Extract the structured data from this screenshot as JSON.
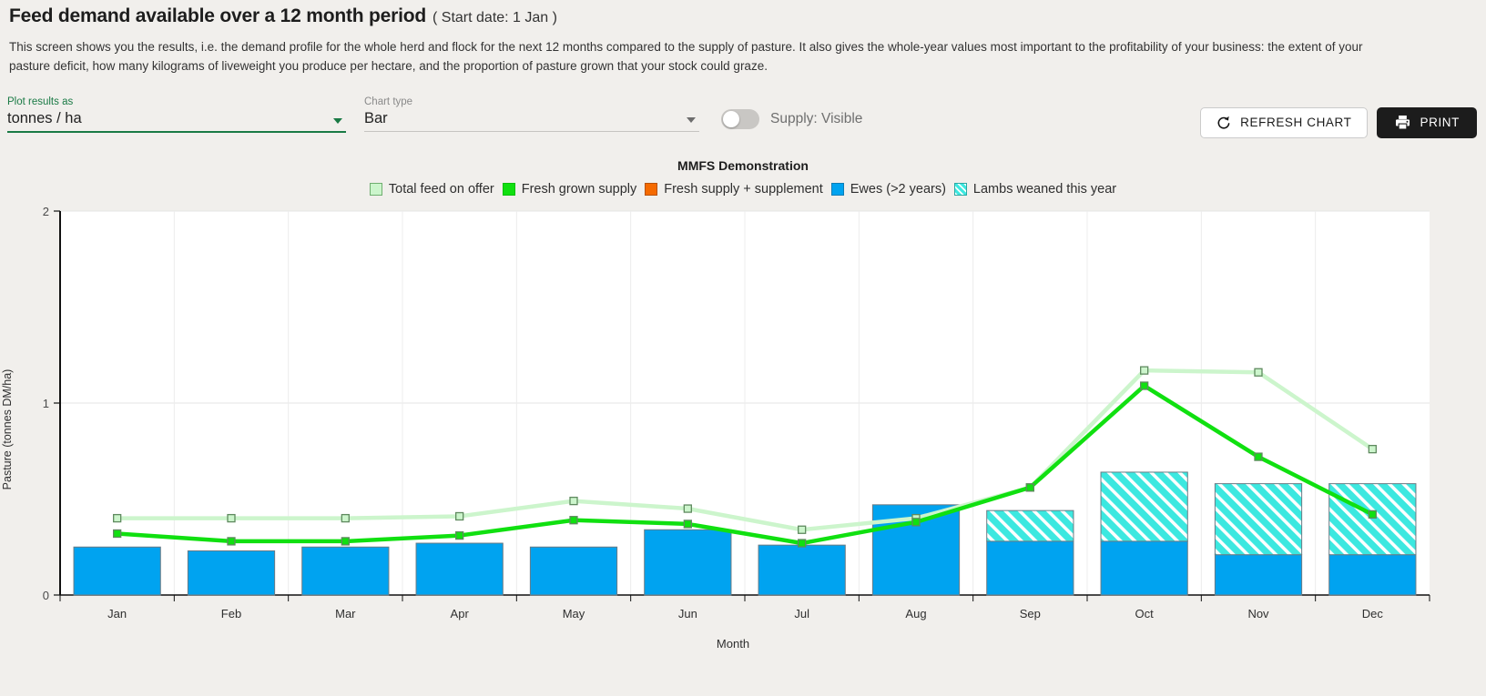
{
  "header": {
    "title": "Feed demand available over a 12 month period",
    "subtitle": "( Start date: 1 Jan )",
    "description": "This screen shows you the results, i.e. the demand profile for the whole herd and flock for the next 12 months compared to the supply of pasture. It also gives the whole-year values most important to the profitability of your business: the extent of your pasture deficit, how many kilograms of liveweight you produce per hectare, and the proportion of pasture grown that your stock could graze."
  },
  "controls": {
    "plot_results_as": {
      "label": "Plot results as",
      "value": "tonnes / ha"
    },
    "chart_type": {
      "label": "Chart type",
      "value": "Bar"
    },
    "supply_toggle": {
      "label": "Supply: Visible",
      "state": "off"
    },
    "refresh_button": "REFRESH CHART",
    "print_button": "PRINT"
  },
  "colors": {
    "total_feed": "#ccf5cc",
    "fresh_grown": "#10e010",
    "fresh_supplement": "#f56a00",
    "ewes": "#00a3f0",
    "lambs": "#3ce8e0",
    "accent_green": "#1a7a45",
    "background": "#f1efec"
  },
  "chart_data": {
    "type": "bar",
    "title": "MMFS Demonstration",
    "xlabel": "Month",
    "ylabel": "Pasture (tonnes DM/ha)",
    "ylim": [
      0,
      2
    ],
    "yticks": [
      0,
      1,
      2
    ],
    "ytick_labels": [
      "0",
      "1",
      "2"
    ],
    "grid": true,
    "legend_position": "top",
    "categories": [
      "Jan",
      "Feb",
      "Mar",
      "Apr",
      "May",
      "Jun",
      "Jul",
      "Aug",
      "Sep",
      "Oct",
      "Nov",
      "Dec"
    ],
    "series": [
      {
        "name": "Total feed on offer",
        "kind": "line",
        "color": "#ccf5cc",
        "values": [
          0.4,
          0.4,
          0.4,
          0.41,
          0.49,
          0.45,
          0.34,
          0.4,
          0.56,
          1.17,
          1.16,
          0.76
        ]
      },
      {
        "name": "Fresh grown supply",
        "kind": "line",
        "color": "#10e010",
        "values": [
          0.32,
          0.28,
          0.28,
          0.31,
          0.39,
          0.37,
          0.27,
          0.38,
          0.56,
          1.09,
          0.72,
          0.42
        ]
      },
      {
        "name": "Fresh supply + supplement",
        "kind": "line",
        "color": "#f56a00",
        "values": []
      },
      {
        "name": "Ewes (>2 years)",
        "kind": "bar",
        "color": "#00a3f0",
        "values": [
          0.25,
          0.23,
          0.25,
          0.27,
          0.25,
          0.34,
          0.26,
          0.47,
          0.28,
          0.28,
          0.21,
          0.21
        ]
      },
      {
        "name": "Lambs weaned this year",
        "kind": "bar",
        "color": "#3ce8e0",
        "hatch": true,
        "values": [
          0,
          0,
          0,
          0,
          0,
          0,
          0,
          0,
          0.16,
          0.36,
          0.37,
          0.37
        ]
      }
    ]
  }
}
